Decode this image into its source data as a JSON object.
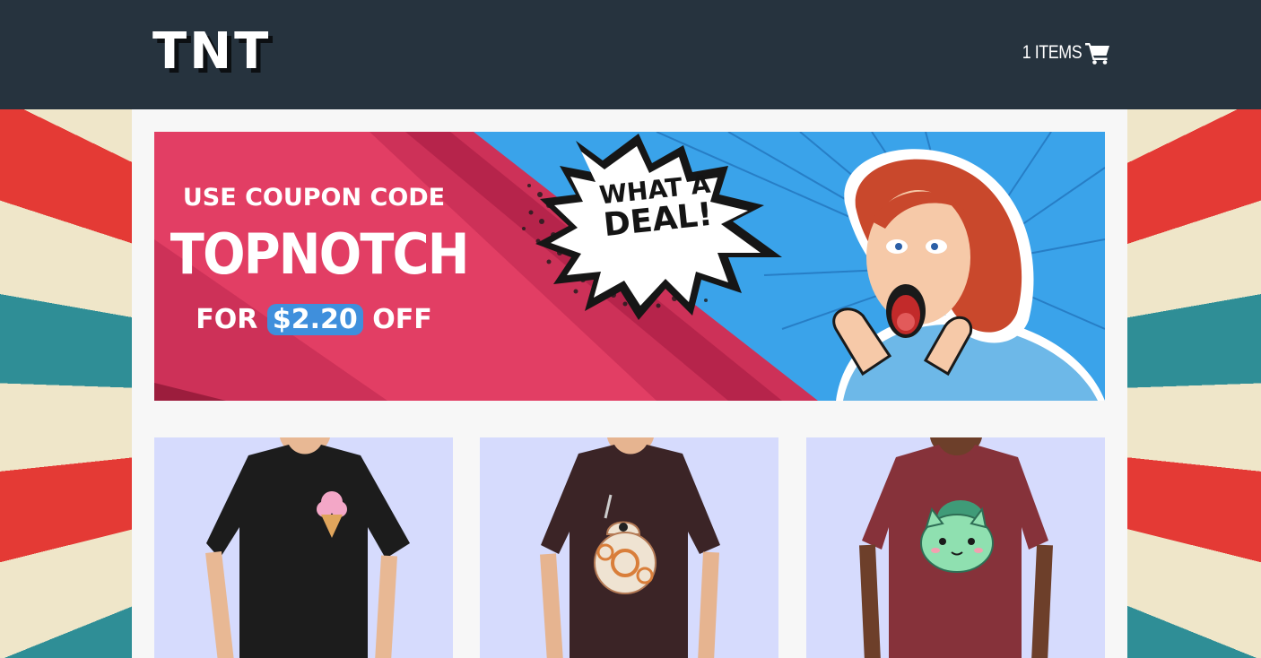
{
  "header": {
    "logo_text": "TNT",
    "cart_label": "1 ITEMS",
    "cart_icon": "shopping-cart-icon"
  },
  "banner": {
    "line1": "USE COUPON CODE",
    "coupon_code": "TOPNOTCH",
    "prefix": "FOR",
    "amount": "$2.20",
    "suffix": "OFF",
    "bubble_line1": "WHAT A",
    "bubble_line2": "DEAL!",
    "colors": {
      "pink": "#e23e64",
      "dark_pink": "#c92e55",
      "blue": "#3aa3ea"
    }
  },
  "products": [
    {
      "shirt_color": "#1c1c1c",
      "design": "ice-cream-cone"
    },
    {
      "shirt_color": "#3b2426",
      "design": "bb8-droid"
    },
    {
      "shirt_color": "#86323a",
      "design": "bulbasaur"
    }
  ],
  "colors": {
    "header_bg": "#26333e",
    "content_bg": "#f7f7f7",
    "card_bg": "#d6dbfd"
  }
}
